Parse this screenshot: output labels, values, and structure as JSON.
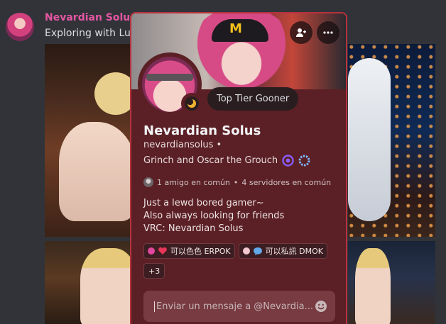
{
  "message": {
    "author": "Nevardian Solus",
    "text": "Exploring with Lu"
  },
  "profile": {
    "display_name": "Nevardian Solus",
    "username": "nevardiansolus",
    "username_separator": "•",
    "pronouns": "Grinch and Oscar the Grouch",
    "custom_status": "Top Tier Gooner",
    "mutual_friends": "1 amigo en común",
    "mutual_separator": "•",
    "mutual_servers": "4 servidores en común",
    "bio": [
      "Just a lewd bored gamer~",
      "Also always looking for friends",
      "VRC: Nevardian Solus"
    ],
    "roles": [
      {
        "label": "可以色色 ERPOK",
        "color": "#e0479e",
        "emoji": "heart-emoji"
      },
      {
        "label": "可以私訊 DMOK",
        "color": "#f2c9d1",
        "emoji": "speech-bubble-emoji"
      }
    ],
    "roles_more": "+3",
    "message_placeholder": "Enviar un mensaje a @Nevardia...",
    "banner_logo": "M"
  },
  "colors": {
    "card_bg": "#5b2025",
    "card_border": "#b7323e",
    "author_color": "#e357a2",
    "input_bg": "#773b41"
  }
}
